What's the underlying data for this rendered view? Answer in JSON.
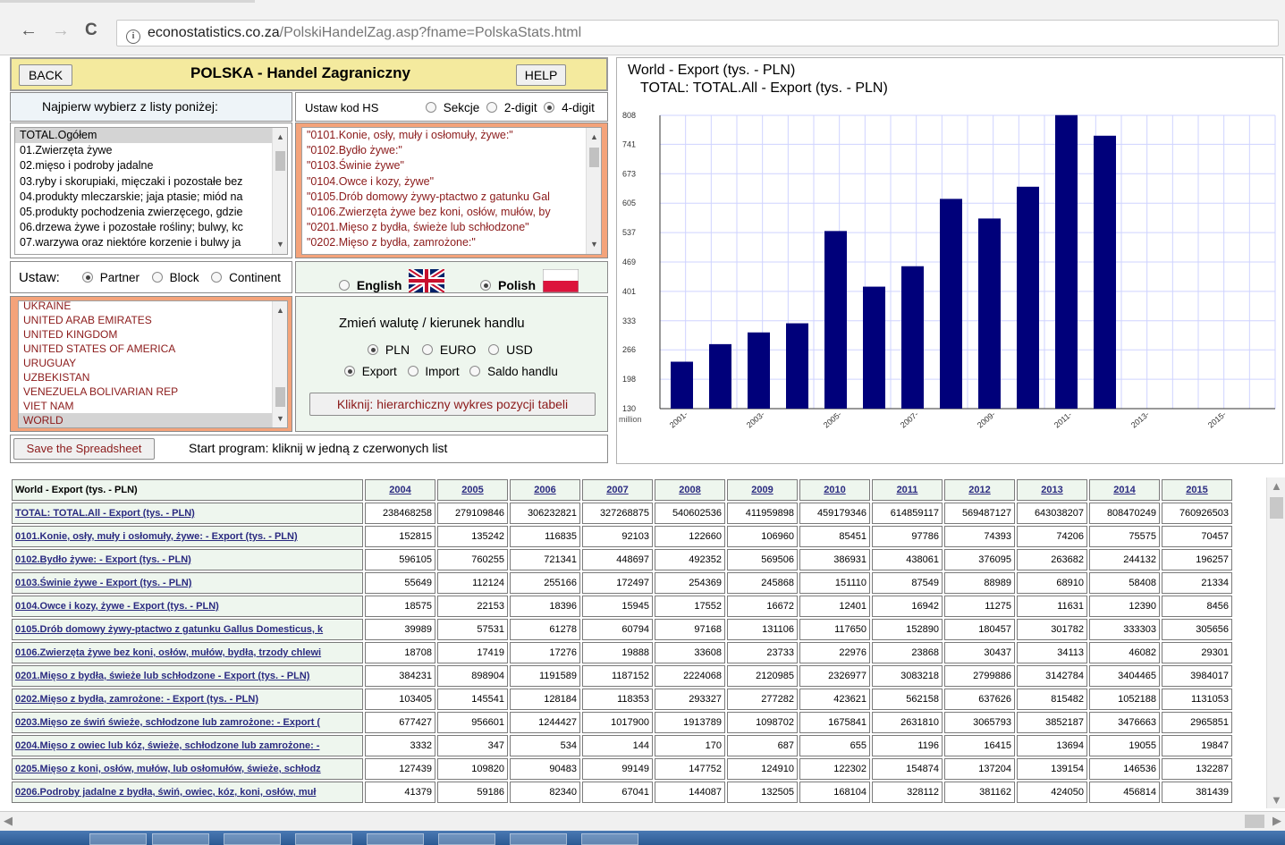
{
  "browser": {
    "url_host": "econostatistics.co.za",
    "url_path": "/PolskiHandelZag.asp?fname=PolskaStats.html",
    "back_arrow": "←",
    "forward_arrow": "→",
    "reload": "C"
  },
  "header": {
    "back_label": "BACK",
    "title": "POLSKA - Handel Zagraniczny",
    "help_label": "HELP"
  },
  "selection": {
    "instruction": "Najpierw wybierz z listy poniżej:",
    "hs_label": "Ustaw kod HS",
    "hs_options": [
      "Sekcje",
      "2-digit",
      "4-digit"
    ],
    "hs_selected": "4-digit",
    "sections": [
      "TOTAL.Ogółem",
      "01.Zwierzęta żywe",
      "02.mięso i podroby jadalne",
      "03.ryby i skorupiaki, mięczaki i pozostałe bez",
      "04.produkty mleczarskie; jaja ptasie; miód na",
      "05.produkty pochodzenia zwierzęcego, gdzie",
      "06.drzewa żywe i pozostałe rośliny; bulwy, kc",
      "07.warzywa oraz niektóre korzenie i bulwy ja"
    ],
    "products": [
      "\"0101.Konie, osły, muły i osłomuły, żywe:\"",
      "\"0102.Bydło żywe:\"",
      "\"0103.Świnie żywe\"",
      "\"0104.Owce i kozy, żywe\"",
      "\"0105.Drób domowy żywy-ptactwo z gatunku Gal",
      "\"0106.Zwierzęta żywe bez koni, osłów, mułów, by",
      "\"0201.Mięso z bydła, świeże lub schłodzone\"",
      "\"0202.Mięso z bydła, zamrożone:\""
    ],
    "set_label": "Ustaw:",
    "partner_options": [
      "Partner",
      "Block",
      "Continent"
    ],
    "partner_selected": "Partner",
    "language_options": [
      "English",
      "Polish"
    ],
    "language_selected": "Polish",
    "countries": [
      "UKRAINE",
      "UNITED ARAB EMIRATES",
      "UNITED KINGDOM",
      "UNITED STATES OF AMERICA",
      "URUGUAY",
      "UZBEKISTAN",
      "VENEZUELA BOLIVARIAN REP",
      "VIET NAM",
      "WORLD"
    ],
    "currency_heading": "Zmień walutę / kierunek handlu",
    "currency_options": [
      "PLN",
      "EURO",
      "USD"
    ],
    "currency_selected": "PLN",
    "direction_options": [
      "Export",
      "Import",
      "Saldo handlu"
    ],
    "direction_selected": "Export",
    "hierarchy_button": "Kliknij: hierarchiczny  wykres pozycji tabeli",
    "save_button": "Save the Spreadsheet",
    "start_text": "Start program:  kliknij w jedną z czerwonych list"
  },
  "colors": {
    "bar": "#00007a",
    "title_bar": "#f4ea9e",
    "orange_frame": "#f4a37a",
    "link": "#2a2a80"
  },
  "chart_data": {
    "type": "bar",
    "title": "World - Export  (tys. - PLN)",
    "subtitle": "TOTAL: TOTAL.All - Export  (tys. - PLN)",
    "unit_label": "million",
    "categories": [
      "2004",
      "2005",
      "2006",
      "2007",
      "2008",
      "2009",
      "2010",
      "2011",
      "2012",
      "2013",
      "2014",
      "2015"
    ],
    "x_tick_labels": [
      "2001-",
      "2003-",
      "2005-",
      "2007-",
      "2009-",
      "2011-",
      "2013-",
      "2015-"
    ],
    "values": [
      238.5,
      279.1,
      306.2,
      327.3,
      540.6,
      412.0,
      459.2,
      614.9,
      569.5,
      643.0,
      808.5,
      760.9
    ],
    "y_ticks": [
      130,
      198,
      266,
      333,
      401,
      469,
      537,
      605,
      673,
      741,
      808
    ],
    "ylim": [
      130,
      808
    ],
    "grid": true
  },
  "table": {
    "corner": "World - Export (tys. - PLN)",
    "years": [
      "2004",
      "2005",
      "2006",
      "2007",
      "2008",
      "2009",
      "2010",
      "2011",
      "2012",
      "2013",
      "2014",
      "2015"
    ],
    "rows": [
      {
        "name": "TOTAL: TOTAL.All - Export (tys. - PLN)",
        "values": [
          "238468258",
          "279109846",
          "306232821",
          "327268875",
          "540602536",
          "411959898",
          "459179346",
          "614859117",
          "569487127",
          "643038207",
          "808470249",
          "760926503"
        ]
      },
      {
        "name": "0101.Konie, osły, muły i osłomuły, żywe: - Export (tys. - PLN)",
        "values": [
          "152815",
          "135242",
          "116835",
          "92103",
          "122660",
          "106960",
          "85451",
          "97786",
          "74393",
          "74206",
          "75575",
          "70457"
        ]
      },
      {
        "name": "0102.Bydło żywe: - Export (tys. - PLN)",
        "values": [
          "596105",
          "760255",
          "721341",
          "448697",
          "492352",
          "569506",
          "386931",
          "438061",
          "376095",
          "263682",
          "244132",
          "196257"
        ]
      },
      {
        "name": "0103.Świnie żywe - Export (tys. - PLN)",
        "values": [
          "55649",
          "112124",
          "255166",
          "172497",
          "254369",
          "245868",
          "151110",
          "87549",
          "88989",
          "68910",
          "58408",
          "21334"
        ]
      },
      {
        "name": "0104.Owce i kozy, żywe - Export (tys. - PLN)",
        "values": [
          "18575",
          "22153",
          "18396",
          "15945",
          "17552",
          "16672",
          "12401",
          "16942",
          "11275",
          "11631",
          "12390",
          "8456"
        ]
      },
      {
        "name": "0105.Drób domowy żywy-ptactwo z gatunku Gallus Domesticus, k",
        "values": [
          "39989",
          "57531",
          "61278",
          "60794",
          "97168",
          "131106",
          "117650",
          "152890",
          "180457",
          "301782",
          "333303",
          "305656"
        ]
      },
      {
        "name": "0106.Zwierzęta żywe bez koni, osłów, mułów, bydła, trzody chlewi",
        "values": [
          "18708",
          "17419",
          "17276",
          "19888",
          "33608",
          "23733",
          "22976",
          "23868",
          "30437",
          "34113",
          "46082",
          "29301"
        ]
      },
      {
        "name": "0201.Mięso z bydła, świeże lub schłodzone - Export (tys. - PLN)",
        "values": [
          "384231",
          "898904",
          "1191589",
          "1187152",
          "2224068",
          "2120985",
          "2326977",
          "3083218",
          "2799886",
          "3142784",
          "3404465",
          "3984017"
        ]
      },
      {
        "name": "0202.Mięso z bydła, zamrożone: - Export (tys. - PLN)",
        "values": [
          "103405",
          "145541",
          "128184",
          "118353",
          "293327",
          "277282",
          "423621",
          "562158",
          "637626",
          "815482",
          "1052188",
          "1131053"
        ]
      },
      {
        "name": "0203.Mięso ze świń świeże, schłodzone lub zamrożone: - Export (",
        "values": [
          "677427",
          "956601",
          "1244427",
          "1017900",
          "1913789",
          "1098702",
          "1675841",
          "2631810",
          "3065793",
          "3852187",
          "3476663",
          "2965851"
        ]
      },
      {
        "name": "0204.Mięso z owiec lub kóz, świeże, schłodzone lub zamrożone: -",
        "values": [
          "3332",
          "347",
          "534",
          "144",
          "170",
          "687",
          "655",
          "1196",
          "16415",
          "13694",
          "19055",
          "19847"
        ]
      },
      {
        "name": "0205.Mięso z koni, osłów, mułów, lub osłomułów, świeże, schłodz",
        "values": [
          "127439",
          "109820",
          "90483",
          "99149",
          "147752",
          "124910",
          "122302",
          "154874",
          "137204",
          "139154",
          "146536",
          "132287"
        ]
      },
      {
        "name": "0206.Podroby jadalne z bydła, świń, owiec, kóz, koni, osłów, muł",
        "values": [
          "41379",
          "59186",
          "82340",
          "67041",
          "144087",
          "132505",
          "168104",
          "328112",
          "381162",
          "424050",
          "456814",
          "381439"
        ]
      }
    ]
  }
}
